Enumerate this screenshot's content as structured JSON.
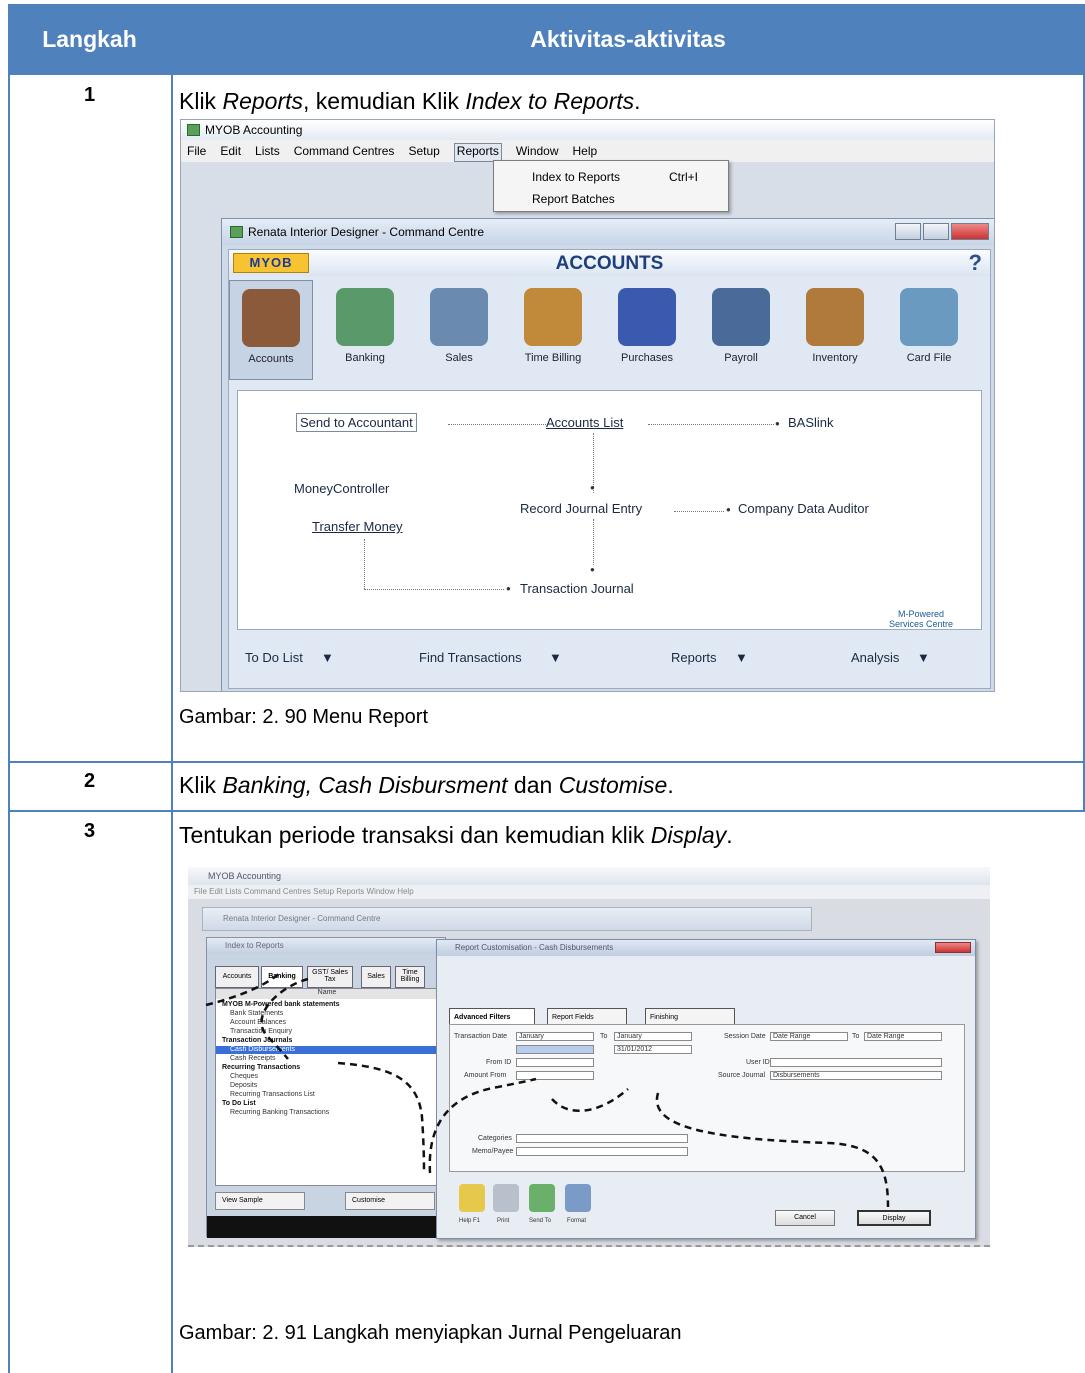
{
  "table": {
    "headers": [
      "Langkah",
      "Aktivitas-aktivitas"
    ],
    "rows": [
      {
        "number": "1",
        "text_parts": [
          "Klik ",
          "Reports",
          ", kemudian Klik ",
          "Index to Reports",
          "."
        ],
        "caption": "Gambar: 2. 90 Menu Report"
      },
      {
        "number": "2",
        "text_parts": [
          "Klik ",
          "Banking, Cash Disbursment",
          " dan ",
          "Customise",
          "."
        ]
      },
      {
        "number": "3",
        "text_parts": [
          "Tentukan periode transaksi dan kemudian klik ",
          "Display",
          "."
        ],
        "caption": "Gambar: 2. 91 Langkah menyiapkan Jurnal Pengeluaran"
      }
    ]
  },
  "screenshot1": {
    "app_title": "MYOB Accounting",
    "menu": [
      "File",
      "Edit",
      "Lists",
      "Command Centres",
      "Setup",
      "Reports",
      "Window",
      "Help"
    ],
    "active_menu": "Reports",
    "dropdown": [
      {
        "label": "Index to Reports",
        "shortcut": "Ctrl+I"
      },
      {
        "label": "Report Batches",
        "shortcut": ""
      }
    ],
    "window_title": "Renata Interior Designer - Command Centre",
    "logo": "MYOB",
    "centre_title": "ACCOUNTS",
    "modules": [
      "Accounts",
      "Banking",
      "Sales",
      "Time Billing",
      "Purchases",
      "Payroll",
      "Inventory",
      "Card File"
    ],
    "module_colors": [
      "#8a5a3a",
      "#5a9a6a",
      "#6a8ab0",
      "#c08a3a",
      "#3a5ab0",
      "#4a6a9a",
      "#b07a3a",
      "#6a9ac0"
    ],
    "flow_items": {
      "send_to_accountant": "Send to Accountant",
      "accounts_list": "Accounts List",
      "baslink": "BASlink",
      "money_controller": "MoneyController",
      "transfer_money": "Transfer Money",
      "record_journal_entry": "Record Journal Entry",
      "company_data_auditor": "Company Data Auditor",
      "transaction_journal": "Transaction Journal",
      "m_powered": "M-Powered Services Centre"
    },
    "bottom_actions": [
      "To Do List",
      "Find Transactions",
      "Reports",
      "Analysis"
    ]
  },
  "screenshot2": {
    "app_title": "MYOB Accounting",
    "menu_text": "File  Edit  Lists  Command Centres  Setup  Reports  Window  Help",
    "cc_title": "Renata Interior Designer - Command Centre",
    "index_title": "Index to Reports",
    "index_tabs": [
      "Accounts",
      "Banking",
      "GST/ Sales Tax",
      "Sales",
      "Time Billing"
    ],
    "list_header": "Name",
    "list_items": [
      {
        "text": "MYOB M-Powered bank statements",
        "bold": true
      },
      {
        "text": "Bank Statements",
        "bold": false
      },
      {
        "text": "Account Balances",
        "bold": false
      },
      {
        "text": "Transaction Enquiry",
        "bold": false
      },
      {
        "text": "Transaction Journals",
        "bold": true
      },
      {
        "text": "Cash Disbursements",
        "bold": false
      },
      {
        "text": "Cash Receipts",
        "bold": false
      },
      {
        "text": "Recurring Transactions",
        "bold": true
      },
      {
        "text": "Cheques",
        "bold": false
      },
      {
        "text": "Deposits",
        "bold": false
      },
      {
        "text": "Recurring Transactions List",
        "bold": false
      },
      {
        "text": "To Do List",
        "bold": true
      },
      {
        "text": "Recurring Banking Transactions",
        "bold": false
      }
    ],
    "index_buttons": [
      "View Sample",
      "Customise"
    ],
    "index_toolbar": [
      "Help F1",
      "Print",
      "Send To"
    ],
    "rc_title": "Report Customisation - Cash Disbursements",
    "rc_tabs": [
      "Advanced Filters",
      "Report Fields",
      "Finishing"
    ],
    "fields": {
      "transaction_date": "Transaction Date",
      "transaction_date_value": "January",
      "to": "To",
      "to_value": "January",
      "to_date": "31/01/2012",
      "from_id": "From ID",
      "amount_from": "Amount From",
      "session_date": "Session Date",
      "date_range": "Date Range",
      "user_ids": "User IDs",
      "source_journal": "Source Journal",
      "source_journal_value": "Disbursements",
      "categories": "Categories",
      "memo_payee": "Memo/Payee"
    },
    "rc_toolbar": [
      "Help F1",
      "Print",
      "Send To",
      "Format"
    ],
    "cancel": "Cancel",
    "display": "Display"
  }
}
